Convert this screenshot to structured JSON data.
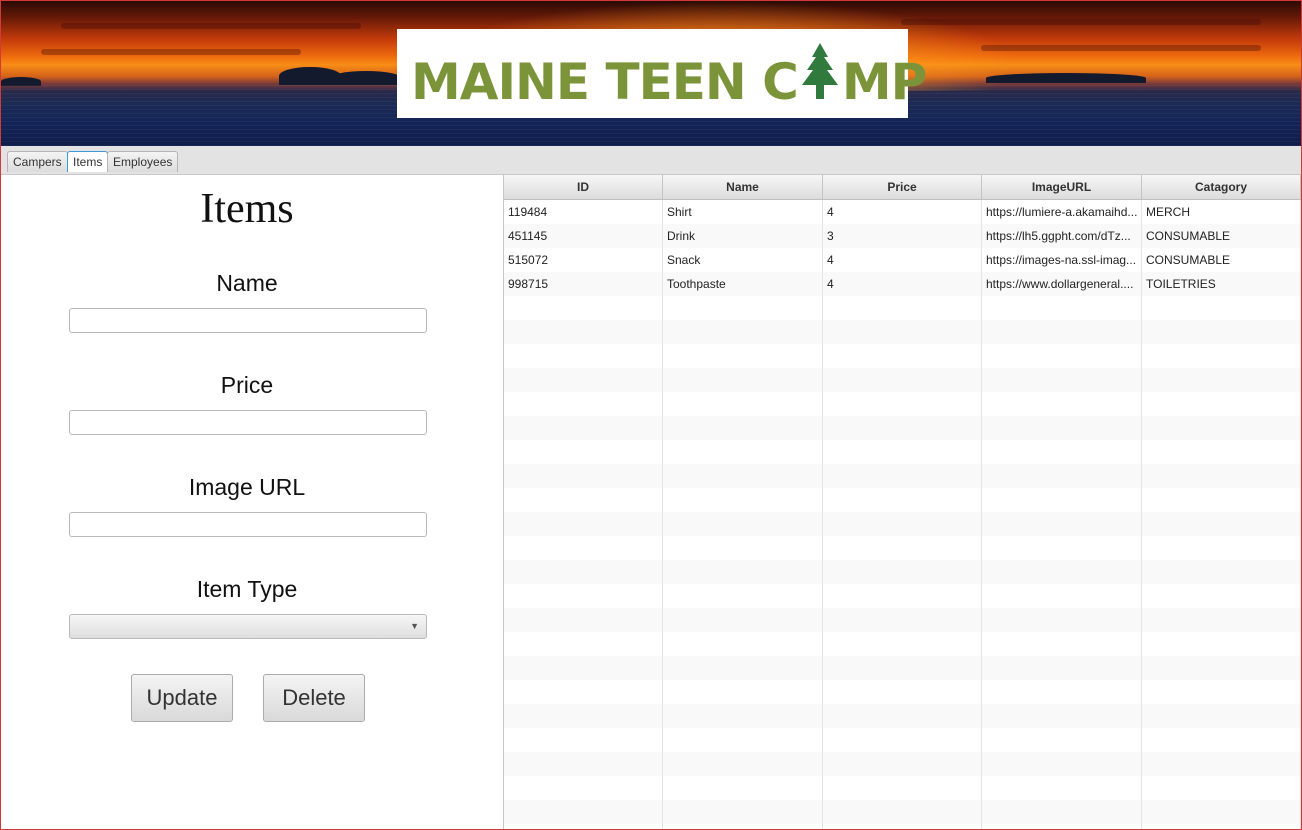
{
  "banner": {
    "logo_text_part1": "MAINE TEEN C",
    "logo_text_part2": "MP",
    "logo_tree_icon": "pine-tree-icon"
  },
  "tabs": [
    {
      "label": "Campers"
    },
    {
      "label": "Items"
    },
    {
      "label": "Employees"
    }
  ],
  "form": {
    "title": "Items",
    "name_label": "Name",
    "name_value": "",
    "price_label": "Price",
    "price_value": "",
    "image_url_label": "Image URL",
    "image_url_value": "",
    "item_type_label": "Item Type",
    "item_type_value": "",
    "update_label": "Update",
    "delete_label": "Delete"
  },
  "table": {
    "columns": [
      "ID",
      "Name",
      "Price",
      "ImageURL",
      "Catagory"
    ],
    "rows": [
      [
        "119484",
        "Shirt",
        "4",
        "https://lumiere-a.akamaihd...",
        "MERCH"
      ],
      [
        "451145",
        "Drink",
        "3",
        "https://lh5.ggpht.com/dTz...",
        "CONSUMABLE"
      ],
      [
        "515072",
        "Snack",
        "4",
        "https://images-na.ssl-imag...",
        "CONSUMABLE"
      ],
      [
        "998715",
        "Toothpaste",
        "4",
        "https://www.dollargeneral....",
        "TOILETRIES"
      ]
    ]
  }
}
